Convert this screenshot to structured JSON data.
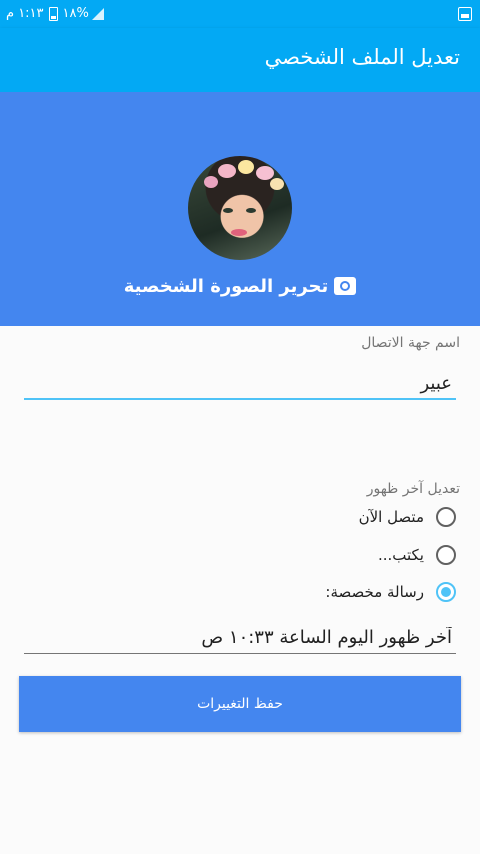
{
  "status_bar": {
    "time": "١:١٣ م",
    "battery": "١٨%"
  },
  "app_bar": {
    "title": "تعديل الملف الشخصي"
  },
  "profile": {
    "edit_photo_label": "تحرير الصورة الشخصية"
  },
  "contact_name": {
    "label": "اسم جهة الاتصال",
    "value": "عبير"
  },
  "last_seen": {
    "label": "تعديل آخر ظهور",
    "options": [
      {
        "label": "متصل الآن",
        "checked": false
      },
      {
        "label": "يكتب...",
        "checked": false
      },
      {
        "label": "رسالة مخصصة:",
        "checked": true
      }
    ],
    "custom_value": "آخر ظهور اليوم الساعة ١٠:٣٣ ص"
  },
  "save_button": {
    "label": "حفظ التغييرات"
  },
  "colors": {
    "app_bar": "#03a9f4",
    "header": "#4486ef",
    "accent": "#4fc3f7"
  }
}
